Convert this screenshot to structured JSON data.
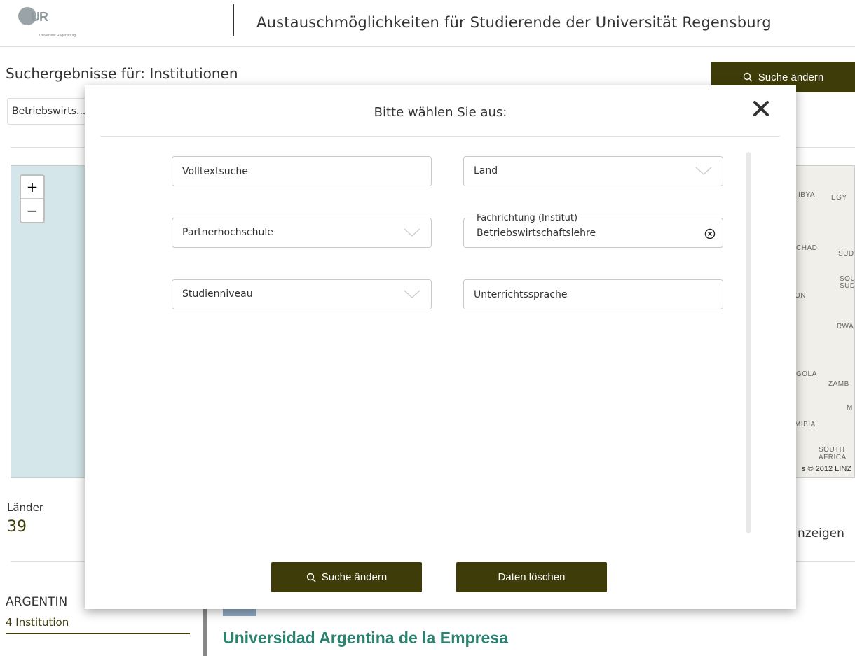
{
  "header": {
    "logo_letters": "UR",
    "logo_subtitle": "Universität Regensburg",
    "title": "Austauschmöglichkeiten für Studierende der Universität Regensburg"
  },
  "page": {
    "results_title": "Suchergebnisse für: Institutionen",
    "top_button_label": "Suche ändern",
    "filter_chip_text": "Betriebswirts..."
  },
  "map": {
    "zoom_in": "+",
    "zoom_out": "−",
    "labels": [
      "IBYA",
      "EGY",
      "CHAD",
      "SUD",
      "SOU",
      "SUD",
      "ON",
      "RWA",
      "GOLA",
      "ZAMB",
      "M",
      "MIBIA",
      "SOUTH",
      "AFRICA"
    ],
    "attribution": "s © 2012 LINZ"
  },
  "stats": {
    "countries_label": "Länder",
    "countries_value": "39",
    "show_link_fragment": "nzeigen"
  },
  "results": {
    "country_name": "ARGENTIN",
    "country_count": "4 Institution",
    "institution_title": "Universidad Argentina de la Empresa"
  },
  "modal": {
    "title": "Bitte wählen Sie aus:",
    "fields": {
      "fulltext_placeholder": "Volltextsuche",
      "land_label": "Land",
      "partner_label": "Partnerhochschule",
      "fachrichtung_label": "Fachrichtung (Institut)",
      "fachrichtung_value": "Betriebswirtschaftslehre",
      "studienniveau_label": "Studienniveau",
      "sprache_placeholder": "Unterrichtssprache"
    },
    "search_button_label": "Suche ändern",
    "clear_button_label": "Daten löschen"
  },
  "colors": {
    "brand_dark": "#3e3d09",
    "link_teal": "#2a8271",
    "map_water": "#d4e6e9"
  }
}
